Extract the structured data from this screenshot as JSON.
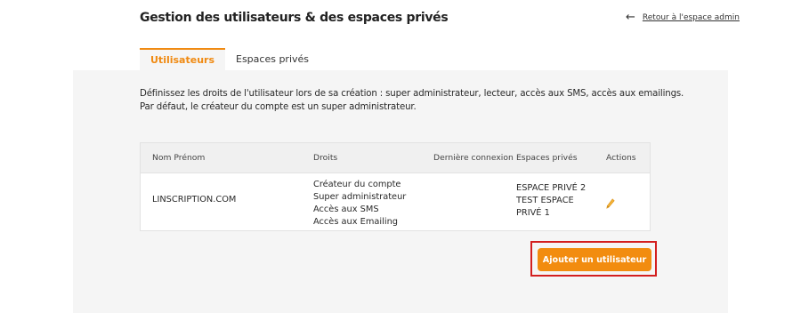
{
  "header": {
    "title": "Gestion des utilisateurs & des espaces privés",
    "back_link_label": "Retour à l'espace admin",
    "back_icon": "arrow-left-icon"
  },
  "tabs": [
    {
      "label": "Utilisateurs",
      "active": true
    },
    {
      "label": "Espaces privés",
      "active": false
    }
  ],
  "description": {
    "line1": "Définissez les droits de l'utilisateur lors de sa création : super administrateur, lecteur, accès aux SMS, accès aux emailings.",
    "line2": "Par défaut, le créateur du compte est un super administrateur."
  },
  "table": {
    "columns": [
      "Nom Prénom",
      "Droits",
      "Dernière connexion",
      "Espaces privés",
      "Actions"
    ],
    "rows": [
      {
        "name": "LINSCRIPTION.COM",
        "rights": [
          "Créateur du compte",
          "Super administrateur",
          "Accès aux SMS",
          "Accès aux Emailing"
        ],
        "last_login": "",
        "private_spaces": [
          "ESPACE PRIVÉ 2",
          "TEST ESPACE",
          "PRIVÉ 1"
        ],
        "action_icon": "pencil-icon"
      }
    ]
  },
  "add_button_label": "Ajouter un utilisateur",
  "colors": {
    "accent": "#f28c0f",
    "highlight": "#d31f1f",
    "panel": "#f5f5f5"
  }
}
